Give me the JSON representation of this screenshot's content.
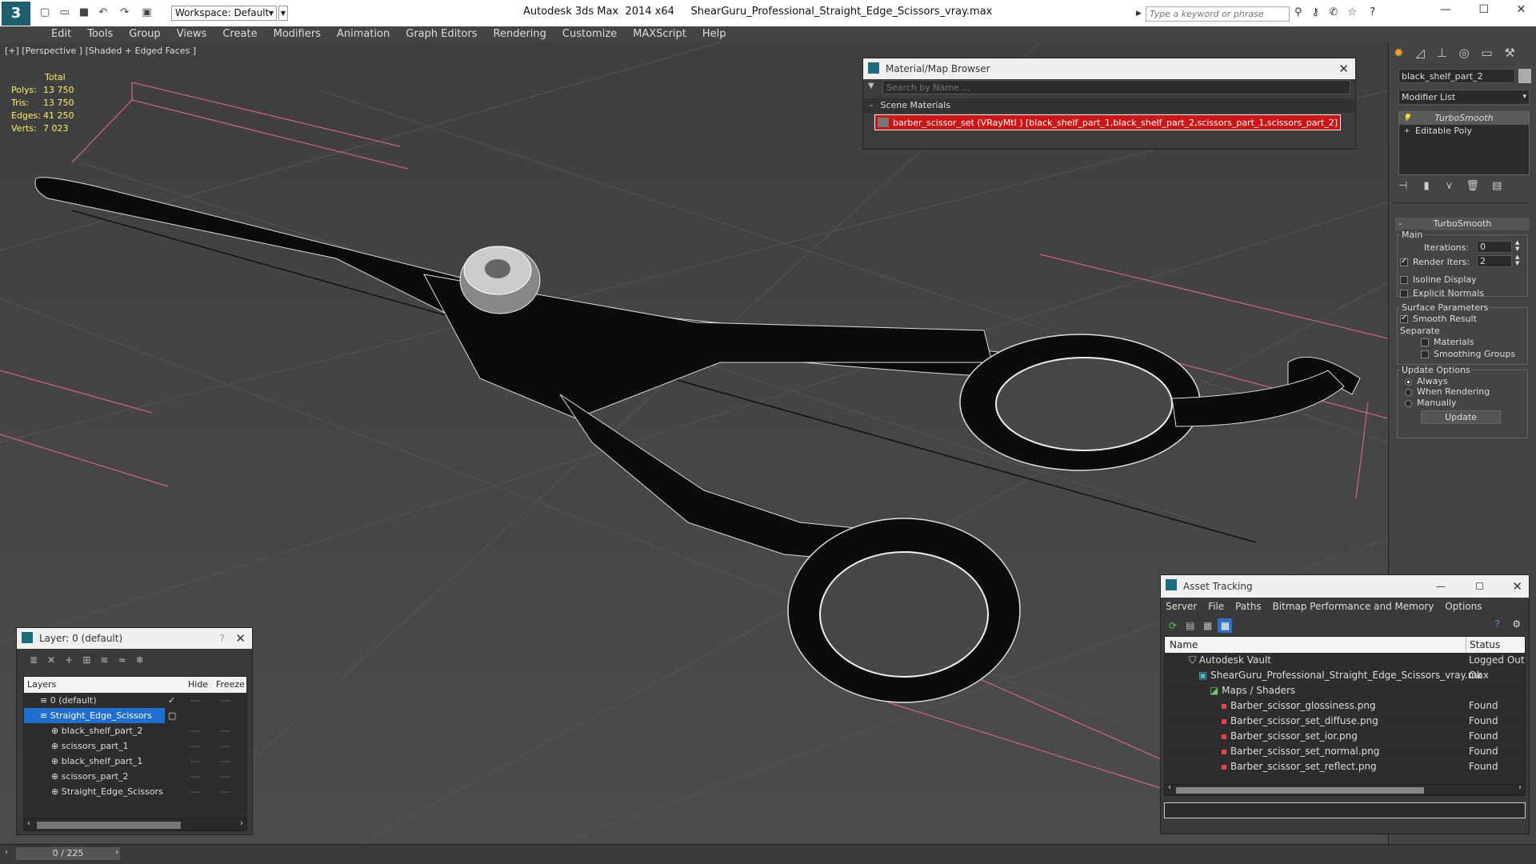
{
  "app": {
    "title": "Autodesk 3ds Max  2014 x64     ShearGuru_Professional_Straight_Edge_Scissors_vray.max",
    "workspace": "Workspace: Default",
    "search_placeholder": "Type a keyword or phrase"
  },
  "menu": [
    "Edit",
    "Tools",
    "Group",
    "Views",
    "Create",
    "Modifiers",
    "Animation",
    "Graph Editors",
    "Rendering",
    "Customize",
    "MAXScript",
    "Help"
  ],
  "viewport": {
    "label": "[+] [Perspective ] [Shaded + Edged Faces ]",
    "stats_header": "Total",
    "stats": [
      {
        "k": "Polys:",
        "v": "13 750"
      },
      {
        "k": "Tris:",
        "v": "13 750"
      },
      {
        "k": "Edges:",
        "v": "41 250"
      },
      {
        "k": "Verts:",
        "v": "7 023"
      }
    ]
  },
  "material_browser": {
    "title": "Material/Map Browser",
    "search_placeholder": "Search by Name ...",
    "section": "Scene Materials",
    "item": "barber_scissor_set (VRayMtl ) [black_shelf_part_1,black_shelf_part_2,scissors_part_1,scissors_part_2]"
  },
  "command_panel": {
    "object_name": "black_shelf_part_2",
    "modifier_list": "Modifier List",
    "stack": [
      "TurboSmooth",
      "Editable Poly"
    ],
    "rollout_title": "TurboSmooth",
    "main_label": "Main",
    "iterations_label": "Iterations:",
    "iterations_value": "0",
    "render_iters_label": "Render Iters:",
    "render_iters_value": "2",
    "isoline": "Isoline Display",
    "explicit_normals": "Explicit Normals",
    "surface_params": "Surface Parameters",
    "smooth_result": "Smooth Result",
    "separate": "Separate",
    "materials": "Materials",
    "smoothing_groups": "Smoothing Groups",
    "update_options": "Update Options",
    "always": "Always",
    "when_rendering": "When Rendering",
    "manually": "Manually",
    "update_button": "Update"
  },
  "layer_panel": {
    "title": "Layer: 0 (default)",
    "columns": [
      "Layers",
      "Hide",
      "Freeze"
    ],
    "rows": [
      {
        "name": "0 (default)",
        "indent": 0
      },
      {
        "name": "Straight_Edge_Scissors",
        "indent": 0
      },
      {
        "name": "black_shelf_part_2",
        "indent": 1
      },
      {
        "name": "scissors_part_1",
        "indent": 1
      },
      {
        "name": "black_shelf_part_1",
        "indent": 1
      },
      {
        "name": "scissors_part_2",
        "indent": 1
      },
      {
        "name": "Straight_Edge_Scissors",
        "indent": 1
      }
    ]
  },
  "asset_tracking": {
    "title": "Asset Tracking",
    "menu": [
      "Server",
      "File",
      "Paths",
      "Bitmap Performance and Memory",
      "Options"
    ],
    "columns": [
      "Name",
      "Status"
    ],
    "rows": [
      {
        "name": "Autodesk Vault",
        "status": "Logged Out ...",
        "indent": 0
      },
      {
        "name": "ShearGuru_Professional_Straight_Edge_Scissors_vray.max",
        "status": "Ok",
        "indent": 1
      },
      {
        "name": "Maps / Shaders",
        "status": "",
        "indent": 2
      },
      {
        "name": "Barber_scissor_glossiness.png",
        "status": "Found",
        "indent": 3
      },
      {
        "name": "Barber_scissor_set_diffuse.png",
        "status": "Found",
        "indent": 3
      },
      {
        "name": "Barber_scissor_set_ior.png",
        "status": "Found",
        "indent": 3
      },
      {
        "name": "Barber_scissor_set_normal.png",
        "status": "Found",
        "indent": 3
      },
      {
        "name": "Barber_scissor_set_reflect.png",
        "status": "Found",
        "indent": 3
      }
    ]
  },
  "timeline": {
    "frame": "0 / 225"
  }
}
